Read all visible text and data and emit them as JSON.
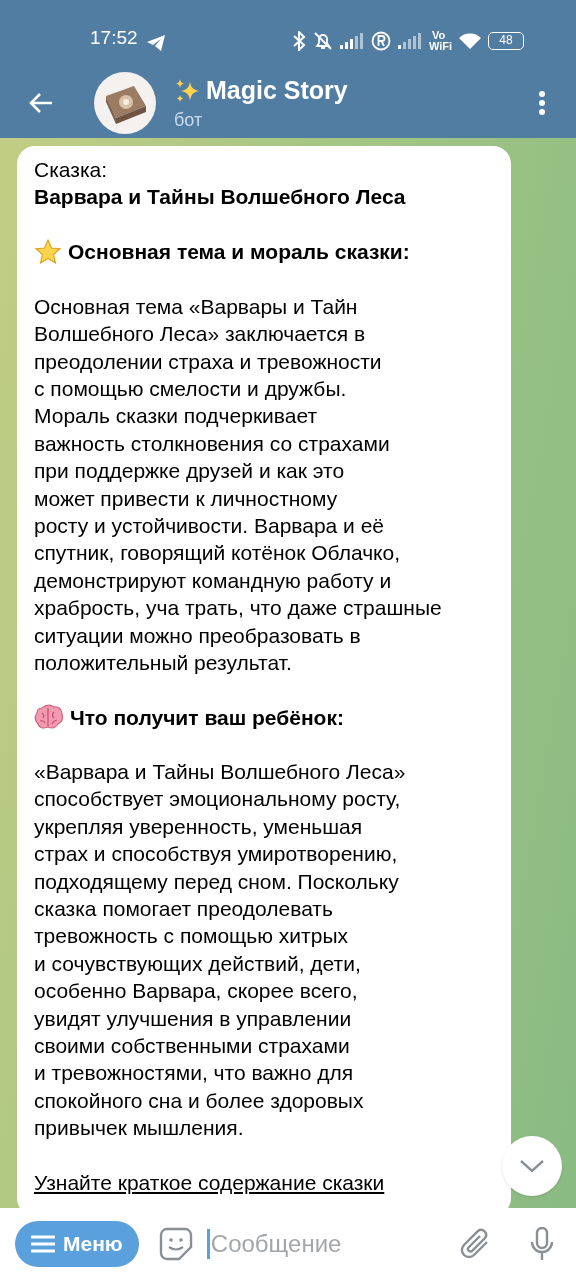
{
  "status_bar": {
    "time": "17:52",
    "volte": [
      "Vo",
      "WiFi"
    ],
    "battery": "48"
  },
  "header": {
    "title": "Magic Story",
    "subtitle": "бот"
  },
  "message": {
    "blocks": [
      {
        "kind": "text",
        "lines": [
          "Сказка:",
          "**Варвара и Тайны Волшебного Леса**"
        ]
      },
      {
        "kind": "heading",
        "lines": [
          "Основная тема и мораль сказки:"
        ]
      },
      {
        "kind": "text",
        "lines": [
          "Основная тема «Варвары и Тайн",
          "Волшебного Леса» заключается в",
          "преодолении страха и тревожности",
          "с помощью смелости и дружбы.",
          "Мораль сказки подчеркивает",
          "важность столкновения со страхами",
          "при поддержке друзей и как это",
          "может привести к личностному",
          "росту и устойчивости. Варвара и её",
          "спутник, говорящий котёнок Облачко,",
          "демонстрируют командную работу и",
          "храбрость, уча трать, что даже страшные",
          "ситуации можно преобразовать в",
          "положительный результат."
        ]
      },
      {
        "kind": "heading",
        "lines": [
          "Что получит ваш ребёнок:"
        ]
      },
      {
        "kind": "text",
        "lines": [
          "«Варвара и Тайны Волшебного Леса»",
          "способствует эмоциональному росту,",
          "укрепляя уверенность, уменьшая",
          "страх и способствуя умиротворению,",
          "подходящему перед сном. Поскольку",
          "сказка помогает преодолевать",
          "тревожность с помощью хитрых",
          "и сочувствующих действий, дети,",
          "особенно Варвара, скорее всего,",
          "увидят улучшения в управлении",
          "своими собственными страхами",
          "и тревожностями, что важно для",
          "спокойного сна и более здоровых",
          "привычек мышления."
        ]
      },
      {
        "kind": "link",
        "lines": [
          "Узнайте краткое содержание сказки"
        ]
      }
    ]
  },
  "composer": {
    "menu_button": "Меню",
    "placeholder": "Сообщение"
  }
}
